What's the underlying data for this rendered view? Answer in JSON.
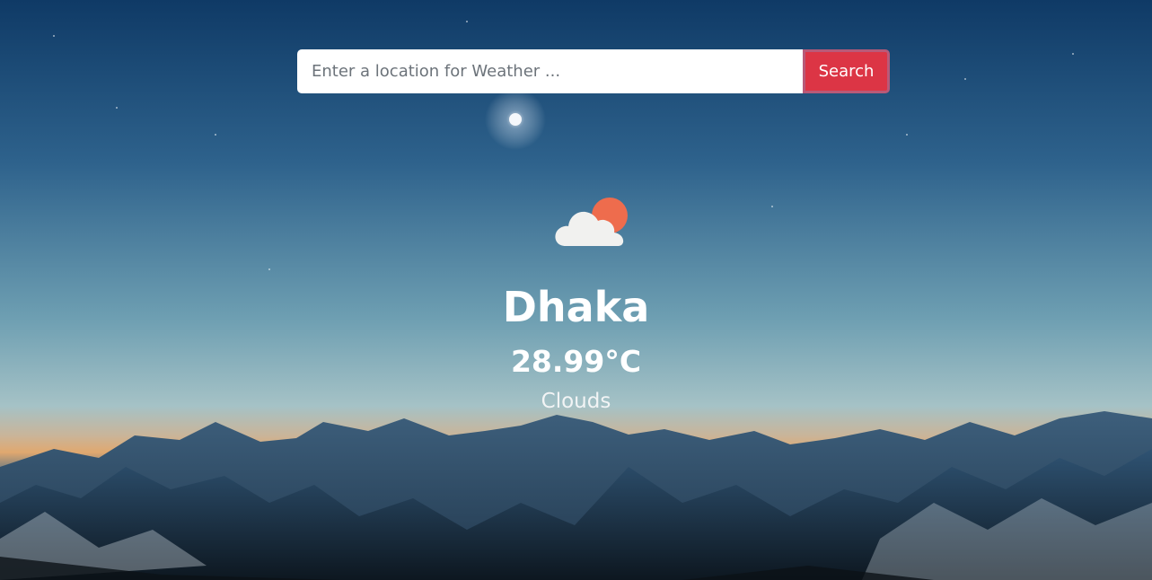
{
  "search": {
    "placeholder": "Enter a location for Weather ...",
    "button_label": "Search"
  },
  "weather": {
    "icon": "cloud-sun-icon",
    "city": "Dhaka",
    "temperature": "28.99°C",
    "condition": "Clouds"
  },
  "colors": {
    "accent": "#dc3545",
    "sun": "#ee6c4d",
    "cloud": "#f1f1ef"
  }
}
